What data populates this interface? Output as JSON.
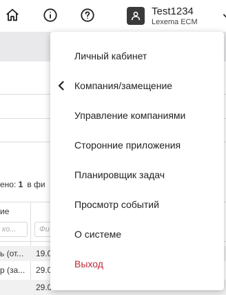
{
  "header": {
    "home_icon": "home-icon",
    "info_icon": "info-icon",
    "help_icon": "help-icon",
    "user": {
      "name": "Test1234",
      "subtitle": "Lexema ECM"
    }
  },
  "background": {
    "found_label": "ено:",
    "found_count": "1",
    "filter_label": "в фи",
    "column_fragment": "ие",
    "filter_placeholder_1": "ко...",
    "filter_placeholder_2": "Фи",
    "rows": [
      {
        "col1": "ь (от...",
        "col2": "19.0"
      },
      {
        "col1": "р (за...",
        "col2": "29.0"
      },
      {
        "col1": "",
        "col2": "29.0"
      }
    ]
  },
  "menu": {
    "items": [
      {
        "label": "Личный кабинет",
        "has_chevron": false
      },
      {
        "label": "Компания/замещение",
        "has_chevron": true
      },
      {
        "label": "Управление компаниями",
        "has_chevron": false
      },
      {
        "label": "Сторонние приложения",
        "has_chevron": false
      },
      {
        "label": "Планировщик задач",
        "has_chevron": false
      },
      {
        "label": "Просмотр событий",
        "has_chevron": false
      },
      {
        "label": "О системе",
        "has_chevron": false
      },
      {
        "label": "Выход",
        "has_chevron": false
      }
    ]
  },
  "colors": {
    "logout": "#c0283b",
    "avatar": "#3a3a3a"
  }
}
